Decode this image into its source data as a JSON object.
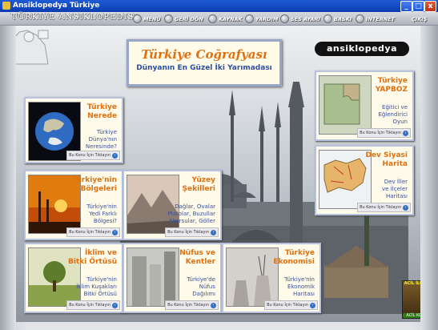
{
  "window": {
    "title": "Ansiklopedya Türkiye",
    "controls": {
      "minimize": "_",
      "maximize": "□",
      "close": "x"
    }
  },
  "toolbar": {
    "logo": "TÜRKIYE ANSIKLOPEDISI",
    "items": [
      {
        "label": "MENÜ",
        "icon": "menu-icon"
      },
      {
        "label": "GERİ DÖN",
        "icon": "back-icon"
      },
      {
        "label": "KAYNAK",
        "icon": "source-icon"
      },
      {
        "label": "YARDIM",
        "icon": "help-icon"
      },
      {
        "label": "SES AYARI",
        "icon": "volume-icon"
      },
      {
        "label": "BASKI",
        "icon": "print-icon"
      },
      {
        "label": "INTERNET",
        "icon": "internet-icon"
      }
    ],
    "exit": "ÇIKIŞ"
  },
  "banner": {
    "title": "Türkiye Coğrafyası",
    "subtitle": "Dünyanın En Güzel İki Yarımadası"
  },
  "brand": "ansiklopedya",
  "more_label": "Bu Konu İçin Tıklayın",
  "cards": [
    {
      "title": [
        "Türkiye",
        "Nerede"
      ],
      "desc": [
        "Türkiye",
        "Dünya'nın",
        "Neresinde?"
      ],
      "icon": "globe-image"
    },
    {
      "title": [
        "Türkiye'nin",
        "Bölgeleri"
      ],
      "desc": [
        "Türkiye'nin",
        "Yedi Farklı",
        "Bölgesi?"
      ],
      "icon": "sunset-image"
    },
    {
      "title": [
        "Yüzey",
        "Şekilleri"
      ],
      "desc": [
        "Dağlar, Ovalar",
        "Platolar, Buzullar",
        "Akarsular, Göller"
      ],
      "icon": "mountain-image"
    },
    {
      "title": [
        "İklim ve",
        "Bitki Örtüsü"
      ],
      "desc": [
        "Türkiye'nin",
        "İklim Kuşakları",
        "Bitki Örtüsü"
      ],
      "icon": "tree-image"
    },
    {
      "title": [
        "Nüfus ve",
        "Kentler"
      ],
      "desc": [
        "Türkiye'de",
        "Nüfus",
        "Dağılımı"
      ],
      "icon": "city-image"
    },
    {
      "title": [
        "Türkiye",
        "Ekonomisi"
      ],
      "desc": [
        "Türkiye'nin",
        "Ekonomik",
        "Haritası"
      ],
      "icon": "powerplant-image"
    },
    {
      "title": [
        "Türkiye",
        "YAPBOZ"
      ],
      "desc": [
        "Eğitici ve",
        "Eğlendirici",
        "Oyun"
      ],
      "icon": "puzzle-image"
    },
    {
      "title": [
        "Dev Siyasi",
        "Harita"
      ],
      "desc": [
        "Dev İller",
        "ve İlçeler",
        "Haritası"
      ],
      "icon": "map-image"
    }
  ],
  "corner_card": {
    "label": "ACİL İLETİŞİM",
    "foot": "ACİL KODLAR"
  },
  "colors": {
    "accent": "#e07010",
    "text_blue": "#3a4f99",
    "titlebar": "#0a3cb0"
  }
}
